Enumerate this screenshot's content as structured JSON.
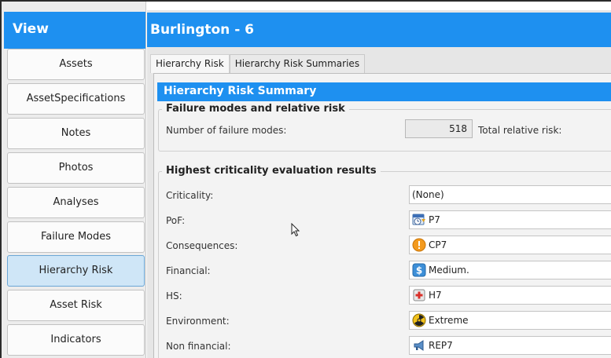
{
  "view_panel": {
    "title": "View",
    "items": [
      {
        "label": "Assets"
      },
      {
        "label": "AssetSpecifications"
      },
      {
        "label": "Notes"
      },
      {
        "label": "Photos"
      },
      {
        "label": "Analyses"
      },
      {
        "label": "Failure Modes"
      },
      {
        "label": "Hierarchy Risk"
      },
      {
        "label": "Asset Risk"
      },
      {
        "label": "Indicators"
      }
    ],
    "active_item": "Hierarchy Risk"
  },
  "main": {
    "title": "Burlington - 6",
    "tabs": [
      {
        "label": "Hierarchy Risk"
      },
      {
        "label": "Hierarchy Risk Summaries"
      }
    ],
    "section_title": "Hierarchy Risk Summary",
    "failure_group": {
      "title": "Failure modes and relative risk",
      "num_label": "Number of failure modes:",
      "num_value": "518",
      "total_label": "Total relative risk:"
    },
    "criticality_group": {
      "title": "Highest criticality evaluation results",
      "rows": [
        {
          "label": "Criticality:",
          "value": "(None)",
          "icon": "none"
        },
        {
          "label": "PoF:",
          "value": "P7",
          "icon": "pof-calendar-icon"
        },
        {
          "label": "Consequences:",
          "value": "CP7",
          "icon": "warning-icon"
        },
        {
          "label": "Financial:",
          "value": "Medium.",
          "icon": "dollar-icon"
        },
        {
          "label": "HS:",
          "value": "H7",
          "icon": "first-aid-icon"
        },
        {
          "label": "Environment:",
          "value": "Extreme",
          "icon": "radiation-icon"
        },
        {
          "label": "Non financial:",
          "value": "REP7",
          "icon": "megaphone-icon"
        }
      ]
    }
  },
  "colors": {
    "accent": "#1e90f0",
    "active_nav": "#cfe6f7",
    "warning": "#f39a1e",
    "dollar": "#3d8fd8"
  }
}
